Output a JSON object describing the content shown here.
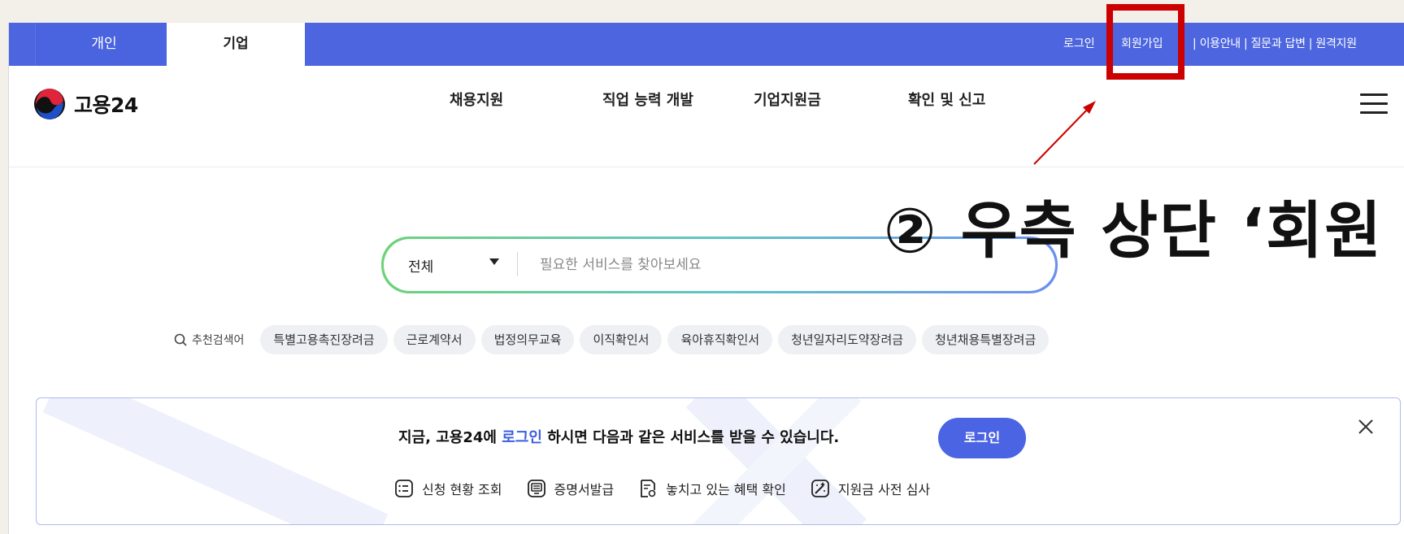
{
  "top_tabs": [
    {
      "label": "개인"
    },
    {
      "label": "기업"
    }
  ],
  "util_links": {
    "login": "로그인",
    "join": "회원가입",
    "rest": "| 이용안내 | 질문과 답변 | 원격지원"
  },
  "logo": {
    "text": "고용24"
  },
  "gnb": [
    "채용지원",
    "직업 능력 개발",
    "기업지원금",
    "확인 및 신고"
  ],
  "search": {
    "category": "전체",
    "placeholder": "필요한 서비스를 찾아보세요"
  },
  "keywords": {
    "label": "추천검색어",
    "items": [
      "특별고용촉진장려금",
      "근로계약서",
      "법정의무교육",
      "이직확인서",
      "육아휴직확인서",
      "청년일자리도약장려금",
      "청년채용특별장려금"
    ]
  },
  "banner": {
    "text_before": "지금, 고용24에 ",
    "text_link": "로그인",
    "text_after": " 하시면 다음과 같은 서비스를 받을 수 있습니다.",
    "login_button": "로그인",
    "services": [
      "신청 현황 조회",
      "증명서발급",
      "놓치고 있는 혜택 확인",
      "지원금 사전 심사"
    ]
  },
  "annotation": {
    "text": "② 우측 상단 ‘회원"
  },
  "colors": {
    "brand_blue": "#4d66e0",
    "annotation_red": "#cc0000"
  }
}
